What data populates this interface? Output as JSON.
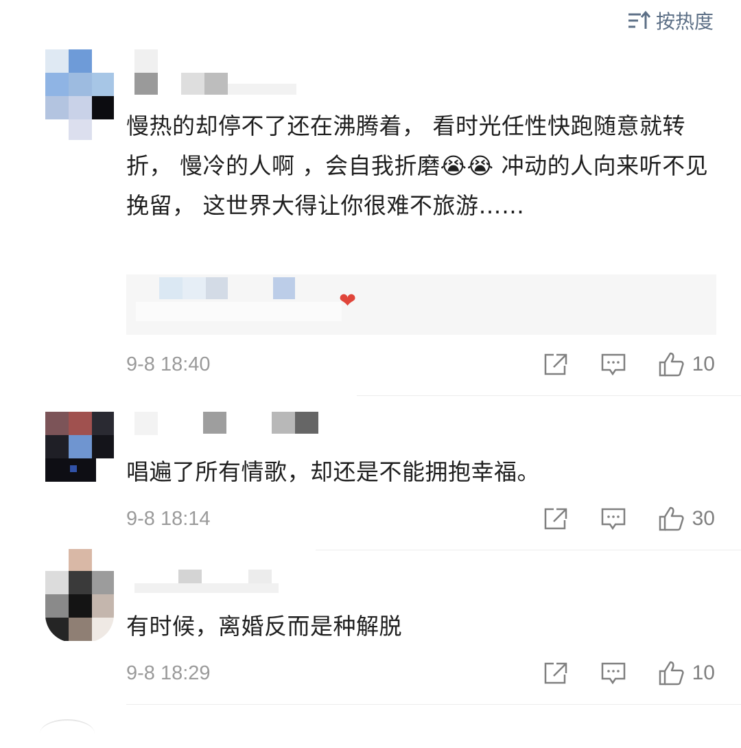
{
  "sort": {
    "label": "按热度",
    "icon": "sort-icon"
  },
  "comments": [
    {
      "text": "慢热的却停不了还在沸腾着， 看时光任性快跑随意就转折， 慢冷的人啊 ，会自我折磨😭😭 冲动的人向来听不见挽留， 这世界大得让你很难不旅游……",
      "reply_heart": "❤",
      "time": "9-8 18:40",
      "likes": "10"
    },
    {
      "text": "唱遍了所有情歌，却还是不能拥抱幸福。",
      "time": "9-8 18:14",
      "likes": "30"
    },
    {
      "text": "有时候，离婚反而是种解脱",
      "time": "9-8 18:29",
      "likes": "10"
    }
  ],
  "icons": {
    "share": "share-icon",
    "comment": "comment-icon",
    "like": "thumbs-up-icon"
  },
  "colors": {
    "sort_accent": "#5c6f86",
    "meta_gray": "#9a9a9a",
    "heart_red": "#e0453a"
  }
}
